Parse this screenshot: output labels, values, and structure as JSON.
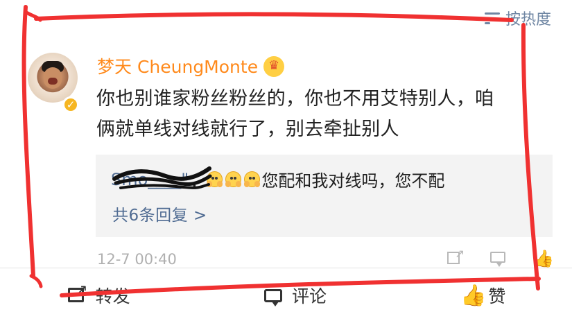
{
  "sort": {
    "label": "按热度",
    "icon": "sort-icon"
  },
  "comment": {
    "author": "梦天 CheungMonte",
    "avatar_icon": "avatar",
    "verified_icon": "verified-badge",
    "member_icon": "crown-badge",
    "text_lines": [
      "你也别谁家粉丝粉丝的，你也不用艾特别人，咱",
      "俩就单线对线就行了，别去牵扯别人"
    ],
    "reply_preview": {
      "user": "Smo____\"",
      "separator": "：",
      "emoji_icon": "face-with-hands-emoji",
      "text": "您配和我对线吗，您不配"
    },
    "replies_link": "共6条回复 >",
    "timestamp": "12-7 00:40"
  },
  "meta_actions": {
    "share_icon": "share-icon",
    "comment_icon": "comment-icon",
    "like_icon": "like-icon"
  },
  "bottom_bar": {
    "forward": "转发",
    "comment": "评论",
    "like": "赞"
  },
  "colors": {
    "accent_orange": "#ff8a1c",
    "link_blue": "#4f6b92",
    "gray_text": "#b0b0b0",
    "annotation_red": "#f03131"
  }
}
